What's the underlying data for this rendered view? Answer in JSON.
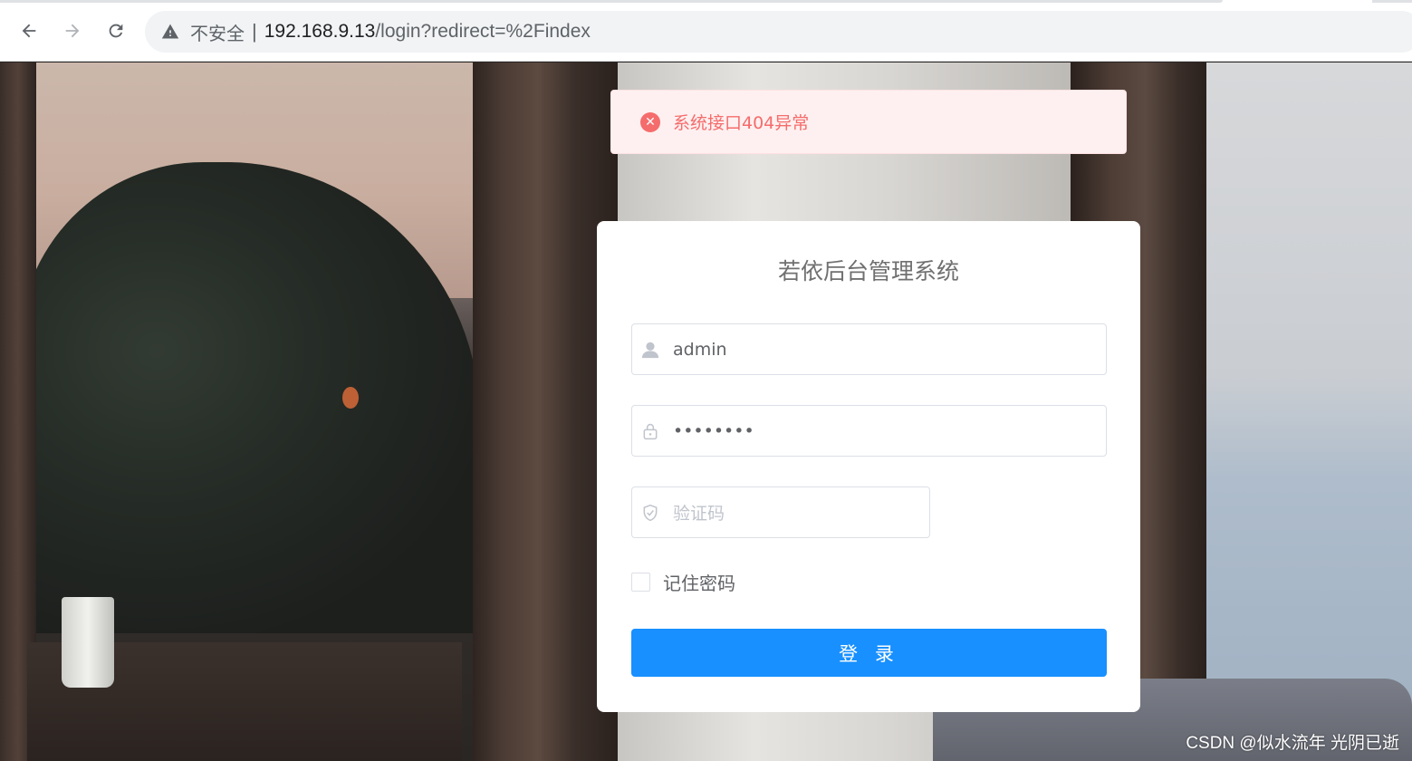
{
  "browser": {
    "insecure_label": "不安全",
    "separator": "|",
    "url_host": "192.168.9.13",
    "url_path": "/login?redirect=%2Findex"
  },
  "alert": {
    "message": "系统接口404异常",
    "color": "#f56c6c"
  },
  "login": {
    "title": "若依后台管理系统",
    "username_value": "admin",
    "password_value": "••••••••",
    "captcha_placeholder": "验证码",
    "remember_label": "记住密码",
    "submit_label": "登 录",
    "accent_color": "#1890ff"
  },
  "watermark": "CSDN @似水流年 光阴已逝"
}
